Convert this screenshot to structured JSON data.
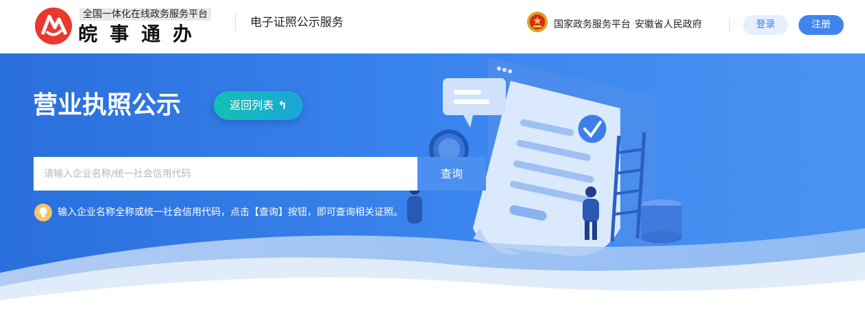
{
  "header": {
    "platform_tag": "全国一体化在线政务服务平台",
    "brand_name": "皖事通办",
    "service_title": "电子证照公示服务",
    "gov_links": [
      "国家政务服务平台",
      "安徽省人民政府"
    ],
    "login_label": "登录",
    "register_label": "注册"
  },
  "banner": {
    "page_heading": "营业执照公示",
    "back_label": "返回列表",
    "search": {
      "placeholder": "请输入企业名称/统一社会信用代码",
      "value": "",
      "button_label": "查询"
    },
    "tip_text": "输入企业名称全称或统一社会信用代码，点击【查询】按钮，即可查询相关证照。"
  },
  "icons": {
    "logo": "anhui-logo-icon",
    "emblem": "national-emblem-icon",
    "back": "return-arrow-icon",
    "tip": "lightbulb-icon"
  },
  "colors": {
    "primary": "#3f85ee",
    "banner": "#2a6fdc",
    "back_button": "#13c0b5",
    "logo_red": "#e8392e",
    "tip_icon": "#f6c36a"
  }
}
